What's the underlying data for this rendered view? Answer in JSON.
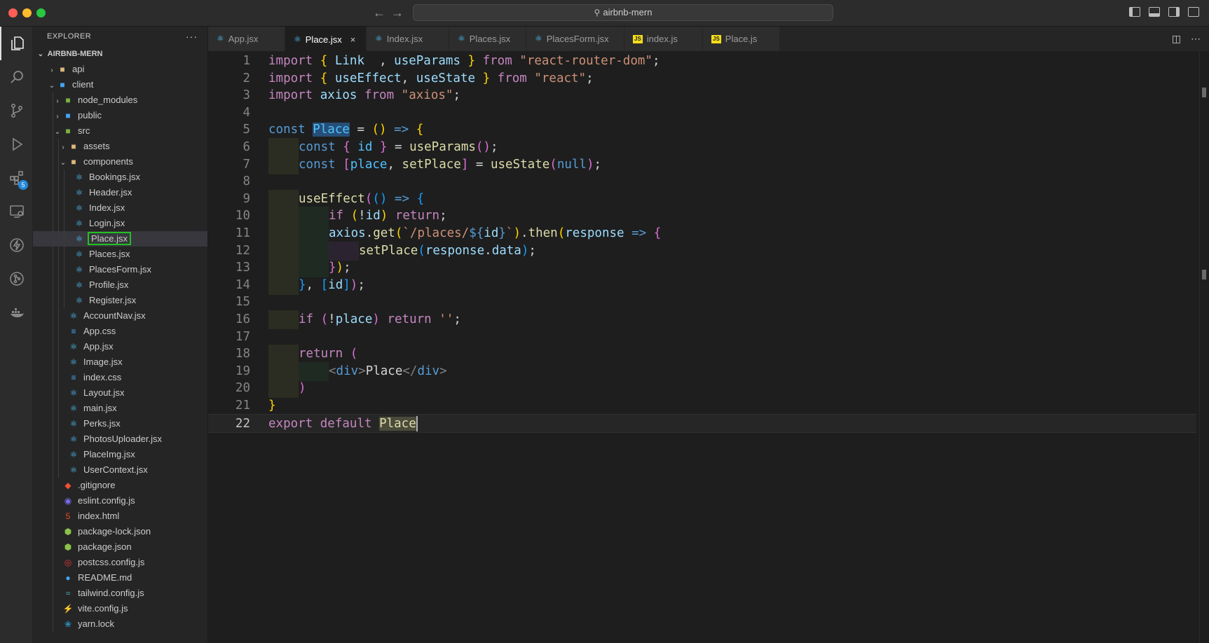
{
  "window": {
    "search_text": "airbnb-mern"
  },
  "activity_bar": {
    "extensions_badge": "5"
  },
  "explorer": {
    "header": "EXPLORER",
    "more": "···",
    "root": "AIRBNB-MERN",
    "rows": [
      {
        "label": "api",
        "depth": 1,
        "chev": "›",
        "icon": "■",
        "icon_class": "fi-folder",
        "name": "folder-api"
      },
      {
        "label": "client",
        "depth": 1,
        "chev": "⌄",
        "icon": "■",
        "icon_class": "fi-folder-blue",
        "name": "folder-client"
      },
      {
        "label": "node_modules",
        "depth": 2,
        "chev": "›",
        "icon": "■",
        "icon_class": "fi-folder-green",
        "name": "folder-node-modules"
      },
      {
        "label": "public",
        "depth": 2,
        "chev": "›",
        "icon": "■",
        "icon_class": "fi-folder-blue",
        "name": "folder-public"
      },
      {
        "label": "src",
        "depth": 2,
        "chev": "⌄",
        "icon": "■",
        "icon_class": "fi-folder-green",
        "name": "folder-src"
      },
      {
        "label": "assets",
        "depth": 3,
        "chev": "›",
        "icon": "■",
        "icon_class": "fi-folder",
        "name": "folder-assets"
      },
      {
        "label": "components",
        "depth": 3,
        "chev": "⌄",
        "icon": "■",
        "icon_class": "fi-folder",
        "name": "folder-components"
      },
      {
        "label": "Bookings.jsx",
        "depth": 4,
        "chev": "",
        "icon": "⚛",
        "icon_class": "fi-react",
        "name": "file-bookings"
      },
      {
        "label": "Header.jsx",
        "depth": 4,
        "chev": "",
        "icon": "⚛",
        "icon_class": "fi-react",
        "name": "file-header"
      },
      {
        "label": "Index.jsx",
        "depth": 4,
        "chev": "",
        "icon": "⚛",
        "icon_class": "fi-react",
        "name": "file-index-jsx"
      },
      {
        "label": "Login.jsx",
        "depth": 4,
        "chev": "",
        "icon": "⚛",
        "icon_class": "fi-react",
        "name": "file-login"
      },
      {
        "label": "Place.jsx",
        "depth": 4,
        "chev": "",
        "icon": "⚛",
        "icon_class": "fi-react",
        "name": "file-place",
        "selected": true
      },
      {
        "label": "Places.jsx",
        "depth": 4,
        "chev": "",
        "icon": "⚛",
        "icon_class": "fi-react",
        "name": "file-places"
      },
      {
        "label": "PlacesForm.jsx",
        "depth": 4,
        "chev": "",
        "icon": "⚛",
        "icon_class": "fi-react",
        "name": "file-placesform"
      },
      {
        "label": "Profile.jsx",
        "depth": 4,
        "chev": "",
        "icon": "⚛",
        "icon_class": "fi-react",
        "name": "file-profile"
      },
      {
        "label": "Register.jsx",
        "depth": 4,
        "chev": "",
        "icon": "⚛",
        "icon_class": "fi-react",
        "name": "file-register"
      },
      {
        "label": "AccountNav.jsx",
        "depth": 3,
        "chev": "",
        "icon": "⚛",
        "icon_class": "fi-react",
        "name": "file-accountnav"
      },
      {
        "label": "App.css",
        "depth": 3,
        "chev": "",
        "icon": "≡",
        "icon_class": "fi-css",
        "name": "file-app-css"
      },
      {
        "label": "App.jsx",
        "depth": 3,
        "chev": "",
        "icon": "⚛",
        "icon_class": "fi-react",
        "name": "file-app-jsx"
      },
      {
        "label": "Image.jsx",
        "depth": 3,
        "chev": "",
        "icon": "⚛",
        "icon_class": "fi-react",
        "name": "file-image"
      },
      {
        "label": "index.css",
        "depth": 3,
        "chev": "",
        "icon": "≡",
        "icon_class": "fi-css",
        "name": "file-index-css"
      },
      {
        "label": "Layout.jsx",
        "depth": 3,
        "chev": "",
        "icon": "⚛",
        "icon_class": "fi-react",
        "name": "file-layout"
      },
      {
        "label": "main.jsx",
        "depth": 3,
        "chev": "",
        "icon": "⚛",
        "icon_class": "fi-react",
        "name": "file-main"
      },
      {
        "label": "Perks.jsx",
        "depth": 3,
        "chev": "",
        "icon": "⚛",
        "icon_class": "fi-react",
        "name": "file-perks"
      },
      {
        "label": "PhotosUploader.jsx",
        "depth": 3,
        "chev": "",
        "icon": "⚛",
        "icon_class": "fi-react",
        "name": "file-photosuploader"
      },
      {
        "label": "PlaceImg.jsx",
        "depth": 3,
        "chev": "",
        "icon": "⚛",
        "icon_class": "fi-react",
        "name": "file-placeimg"
      },
      {
        "label": "UserContext.jsx",
        "depth": 3,
        "chev": "",
        "icon": "⚛",
        "icon_class": "fi-react",
        "name": "file-usercontext"
      },
      {
        "label": ".gitignore",
        "depth": 2,
        "chev": "",
        "icon": "◆",
        "icon_class": "fi-git",
        "name": "file-gitignore"
      },
      {
        "label": "eslint.config.js",
        "depth": 2,
        "chev": "",
        "icon": "◉",
        "icon_class": "fi-eslint",
        "name": "file-eslint"
      },
      {
        "label": "index.html",
        "depth": 2,
        "chev": "",
        "icon": "5",
        "icon_class": "fi-html",
        "name": "file-index-html"
      },
      {
        "label": "package-lock.json",
        "depth": 2,
        "chev": "",
        "icon": "⬢",
        "icon_class": "fi-npm",
        "name": "file-package-lock"
      },
      {
        "label": "package.json",
        "depth": 2,
        "chev": "",
        "icon": "⬢",
        "icon_class": "fi-npm",
        "name": "file-package-json"
      },
      {
        "label": "postcss.config.js",
        "depth": 2,
        "chev": "",
        "icon": "◎",
        "icon_class": "fi-postcss",
        "name": "file-postcss"
      },
      {
        "label": "README.md",
        "depth": 2,
        "chev": "",
        "icon": "●",
        "icon_class": "fi-readme",
        "name": "file-readme"
      },
      {
        "label": "tailwind.config.js",
        "depth": 2,
        "chev": "",
        "icon": "≈",
        "icon_class": "fi-tailwind",
        "name": "file-tailwind"
      },
      {
        "label": "vite.config.js",
        "depth": 2,
        "chev": "",
        "icon": "⚡",
        "icon_class": "fi-vite",
        "name": "file-vite"
      },
      {
        "label": "yarn.lock",
        "depth": 2,
        "chev": "",
        "icon": "❀",
        "icon_class": "fi-yarn",
        "name": "file-yarn-lock"
      }
    ]
  },
  "tabs": [
    {
      "label": "App.jsx",
      "icon": "⚛",
      "icon_class": "fi-react",
      "active": false
    },
    {
      "label": "Place.jsx",
      "icon": "⚛",
      "icon_class": "fi-react",
      "active": true,
      "close": "×"
    },
    {
      "label": "Index.jsx",
      "icon": "⚛",
      "icon_class": "fi-react",
      "active": false
    },
    {
      "label": "Places.jsx",
      "icon": "⚛",
      "icon_class": "fi-react",
      "active": false
    },
    {
      "label": "PlacesForm.jsx",
      "icon": "⚛",
      "icon_class": "fi-react",
      "active": false
    },
    {
      "label": "index.js",
      "icon": "JS",
      "icon_class": "fi-js",
      "active": false
    },
    {
      "label": "Place.js",
      "icon": "JS",
      "icon_class": "fi-js",
      "active": false
    }
  ],
  "editor": {
    "current_line": 22,
    "lines": [
      {
        "n": "1",
        "indent": 0,
        "tokens": [
          [
            "kw",
            "import "
          ],
          [
            "b1",
            "{ "
          ],
          [
            "vr",
            "Link"
          ],
          [
            "",
            "  , "
          ],
          [
            "vr",
            "useParams"
          ],
          [
            "b1",
            " }"
          ],
          [
            "kw",
            " from "
          ],
          [
            "st",
            "\"react-router-dom\""
          ],
          [
            "",
            ";"
          ]
        ]
      },
      {
        "n": "2",
        "indent": 0,
        "tokens": [
          [
            "kw",
            "import "
          ],
          [
            "b1",
            "{ "
          ],
          [
            "vr",
            "useEffect"
          ],
          [
            "",
            ", "
          ],
          [
            "vr",
            "useState"
          ],
          [
            "b1",
            " }"
          ],
          [
            "kw",
            " from "
          ],
          [
            "st",
            "\"react\""
          ],
          [
            "",
            ";"
          ]
        ]
      },
      {
        "n": "3",
        "indent": 0,
        "tokens": [
          [
            "kw",
            "import "
          ],
          [
            "vr",
            "axios"
          ],
          [
            "kw",
            " from "
          ],
          [
            "st",
            "\"axios\""
          ],
          [
            "",
            ";"
          ]
        ]
      },
      {
        "n": "4",
        "indent": 0,
        "tokens": []
      },
      {
        "n": "5",
        "indent": 0,
        "tokens": [
          [
            "kwb",
            "const "
          ],
          [
            "cn selhl",
            "Place"
          ],
          [
            "",
            " = "
          ],
          [
            "b1",
            "()"
          ],
          [
            "kwb",
            " => "
          ],
          [
            "b1",
            "{"
          ]
        ]
      },
      {
        "n": "6",
        "indent": 1,
        "tokens": [
          [
            "kwb",
            "const "
          ],
          [
            "b2",
            "{ "
          ],
          [
            "cn",
            "id"
          ],
          [
            "b2",
            " }"
          ],
          [
            "",
            " = "
          ],
          [
            "fn",
            "useParams"
          ],
          [
            "b2",
            "()"
          ],
          [
            "",
            ";"
          ]
        ]
      },
      {
        "n": "7",
        "indent": 1,
        "tokens": [
          [
            "kwb",
            "const "
          ],
          [
            "b2",
            "["
          ],
          [
            "cn",
            "place"
          ],
          [
            "",
            ", "
          ],
          [
            "fn",
            "setPlace"
          ],
          [
            "b2",
            "]"
          ],
          [
            "",
            " = "
          ],
          [
            "fn",
            "useState"
          ],
          [
            "b2",
            "("
          ],
          [
            "kwb",
            "null"
          ],
          [
            "b2",
            ")"
          ],
          [
            "",
            ";"
          ]
        ]
      },
      {
        "n": "8",
        "indent": 0,
        "tokens": []
      },
      {
        "n": "9",
        "indent": 1,
        "tokens": [
          [
            "fn",
            "useEffect"
          ],
          [
            "b2",
            "("
          ],
          [
            "b3",
            "()"
          ],
          [
            "kwb",
            " => "
          ],
          [
            "b3",
            "{"
          ]
        ]
      },
      {
        "n": "10",
        "indent": 2,
        "tokens": [
          [
            "kw",
            "if "
          ],
          [
            "b1",
            "("
          ],
          [
            "",
            "!"
          ],
          [
            "vr",
            "id"
          ],
          [
            "b1",
            ")"
          ],
          [
            "kw",
            " return"
          ],
          [
            "",
            ";"
          ]
        ]
      },
      {
        "n": "11",
        "indent": 2,
        "tokens": [
          [
            "vr",
            "axios"
          ],
          [
            "",
            "."
          ],
          [
            "fn",
            "get"
          ],
          [
            "b1",
            "("
          ],
          [
            "st",
            "`/places/"
          ],
          [
            "kwb",
            "${"
          ],
          [
            "vr",
            "id"
          ],
          [
            "kwb",
            "}"
          ],
          [
            "st",
            "`"
          ],
          [
            "b1",
            ")"
          ],
          [
            "",
            "."
          ],
          [
            "fn",
            "then"
          ],
          [
            "b1",
            "("
          ],
          [
            "vr",
            "response"
          ],
          [
            "kwb",
            " => "
          ],
          [
            "b2",
            "{"
          ]
        ]
      },
      {
        "n": "12",
        "indent": 3,
        "tokens": [
          [
            "fn",
            "setPlace"
          ],
          [
            "b3",
            "("
          ],
          [
            "vr",
            "response"
          ],
          [
            "",
            "."
          ],
          [
            "vr",
            "data"
          ],
          [
            "b3",
            ")"
          ],
          [
            "",
            ";"
          ]
        ]
      },
      {
        "n": "13",
        "indent": 2,
        "tokens": [
          [
            "b2",
            "}"
          ],
          [
            "b1",
            ")"
          ],
          [
            "",
            ";"
          ]
        ]
      },
      {
        "n": "14",
        "indent": 1,
        "tokens": [
          [
            "b3",
            "}"
          ],
          [
            "",
            ", "
          ],
          [
            "b3",
            "["
          ],
          [
            "vr",
            "id"
          ],
          [
            "b3",
            "]"
          ],
          [
            "b2",
            ")"
          ],
          [
            "",
            ";"
          ]
        ]
      },
      {
        "n": "15",
        "indent": 0,
        "tokens": []
      },
      {
        "n": "16",
        "indent": 1,
        "tokens": [
          [
            "kw",
            "if "
          ],
          [
            "b2",
            "("
          ],
          [
            "",
            "!"
          ],
          [
            "vr",
            "place"
          ],
          [
            "b2",
            ")"
          ],
          [
            "kw",
            " return "
          ],
          [
            "st",
            "''"
          ],
          [
            "",
            ";"
          ]
        ]
      },
      {
        "n": "17",
        "indent": 0,
        "tokens": []
      },
      {
        "n": "18",
        "indent": 1,
        "tokens": [
          [
            "kw",
            "return "
          ],
          [
            "b2",
            "("
          ]
        ]
      },
      {
        "n": "19",
        "indent": 2,
        "tokens": [
          [
            "tg",
            "<"
          ],
          [
            "tgn",
            "div"
          ],
          [
            "tg",
            ">"
          ],
          [
            "",
            "Place"
          ],
          [
            "tg",
            "</"
          ],
          [
            "tgn",
            "div"
          ],
          [
            "tg",
            ">"
          ]
        ]
      },
      {
        "n": "20",
        "indent": 1,
        "tokens": [
          [
            "b2",
            ")"
          ]
        ]
      },
      {
        "n": "21",
        "indent": 0,
        "tokens": [
          [
            "b1",
            "}"
          ]
        ]
      },
      {
        "n": "22",
        "indent": 0,
        "tokens": [
          [
            "kw",
            "export "
          ],
          [
            "kw",
            "default "
          ],
          [
            "fn wordhl",
            "Place"
          ]
        ]
      }
    ]
  }
}
